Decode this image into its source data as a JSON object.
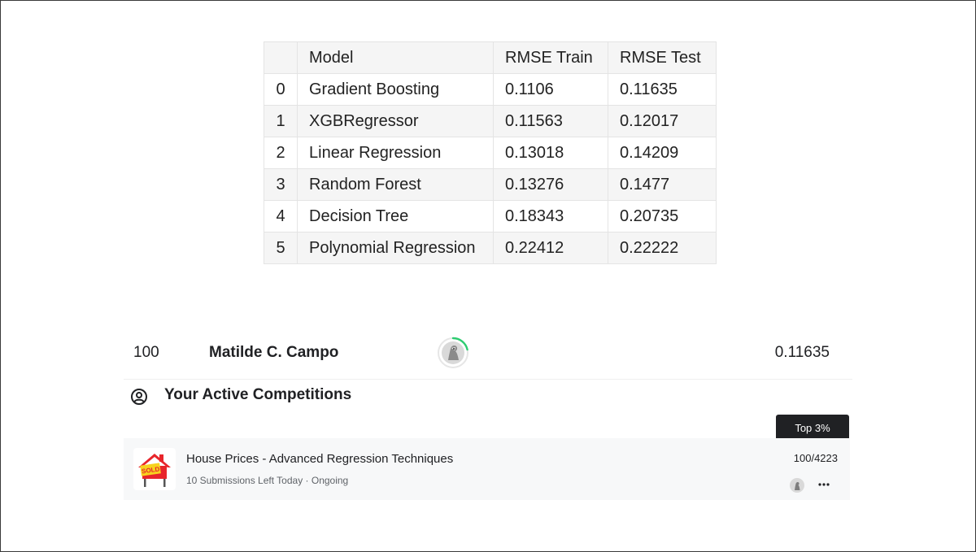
{
  "results_table": {
    "columns": [
      "",
      "Model",
      "RMSE Train",
      "RMSE Test"
    ],
    "rows": [
      {
        "index": "0",
        "model": "Gradient Boosting",
        "rmse_train": "0.1106",
        "rmse_test": "0.11635"
      },
      {
        "index": "1",
        "model": "XGBRegressor",
        "rmse_train": "0.11563",
        "rmse_test": "0.12017"
      },
      {
        "index": "2",
        "model": "Linear Regression",
        "rmse_train": "0.13018",
        "rmse_test": "0.14209"
      },
      {
        "index": "3",
        "model": "Random Forest",
        "rmse_train": "0.13276",
        "rmse_test": "0.1477"
      },
      {
        "index": "4",
        "model": "Decision Tree",
        "rmse_train": "0.18343",
        "rmse_test": "0.20735"
      },
      {
        "index": "5",
        "model": "Polynomial Regression",
        "rmse_train": "0.22412",
        "rmse_test": "0.22222"
      }
    ]
  },
  "leaderboard_row": {
    "rank": "100",
    "name": "Matilde C. Campo",
    "avatar_icon": "user-avatar-icon",
    "score": "0.11635",
    "progress_ring_color": "#20beff"
  },
  "active_competitions": {
    "title": "Your Active Competitions",
    "icon": "user-circle-icon",
    "tooltip": "Top 3%",
    "items": [
      {
        "title": "House Prices - Advanced Regression Techniques",
        "subtitle": "10 Submissions Left Today · Ongoing",
        "rank": "100/4223",
        "thumbnail_icon": "house-sold-icon",
        "thumbnail_text": "SOLD",
        "avatar_icon": "user-avatar-icon",
        "more_icon": "more-horizontal-icon"
      }
    ]
  },
  "colors": {
    "ring": "#2ecc71",
    "house_red": "#e8252b",
    "sold_yellow": "#f7d21e"
  }
}
